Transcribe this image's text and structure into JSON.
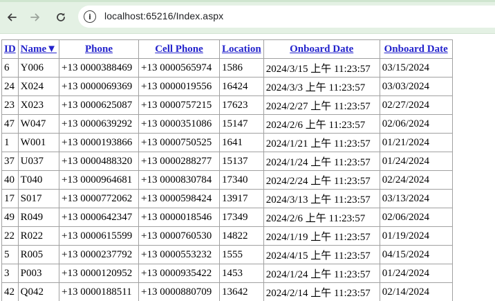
{
  "browser": {
    "url": "localhost:65216/Index.aspx",
    "site_info_glyph": "i",
    "icons": {
      "back": "arrow-left",
      "forward": "arrow-right",
      "reload": "reload"
    }
  },
  "table": {
    "headers": [
      "ID",
      "Name▼",
      "Phone",
      "Cell Phone",
      "Location",
      "Onboard Date",
      "Onboard Date"
    ],
    "rows": [
      [
        "6",
        "Y006",
        "+13 0000388469",
        "+13 0000565974",
        "1586",
        "2024/3/15 上午 11:23:57",
        "03/15/2024"
      ],
      [
        "24",
        "X024",
        "+13 0000069369",
        "+13 0000019556",
        "16424",
        "2024/3/3 上午 11:23:57",
        "03/03/2024"
      ],
      [
        "23",
        "X023",
        "+13 0000625087",
        "+13 0000757215",
        "17623",
        "2024/2/27 上午 11:23:57",
        "02/27/2024"
      ],
      [
        "47",
        "W047",
        "+13 0000639292",
        "+13 0000351086",
        "15147",
        "2024/2/6 上午 11:23:57",
        "02/06/2024"
      ],
      [
        "1",
        "W001",
        "+13 0000193866",
        "+13 0000750525",
        "1641",
        "2024/1/21 上午 11:23:57",
        "01/21/2024"
      ],
      [
        "37",
        "U037",
        "+13 0000488320",
        "+13 0000288277",
        "15137",
        "2024/1/24 上午 11:23:57",
        "01/24/2024"
      ],
      [
        "40",
        "T040",
        "+13 0000964681",
        "+13 0000830784",
        "17340",
        "2024/2/24 上午 11:23:57",
        "02/24/2024"
      ],
      [
        "17",
        "S017",
        "+13 0000772062",
        "+13 0000598424",
        "13917",
        "2024/3/13 上午 11:23:57",
        "03/13/2024"
      ],
      [
        "49",
        "R049",
        "+13 0000642347",
        "+13 0000018546",
        "17349",
        "2024/2/6 上午 11:23:57",
        "02/06/2024"
      ],
      [
        "22",
        "R022",
        "+13 0000615599",
        "+13 0000760530",
        "14822",
        "2024/1/19 上午 11:23:57",
        "01/19/2024"
      ],
      [
        "5",
        "R005",
        "+13 0000237792",
        "+13 0000553232",
        "1555",
        "2024/4/15 上午 11:23:57",
        "04/15/2024"
      ],
      [
        "3",
        "P003",
        "+13 0000120952",
        "+13 0000935422",
        "1453",
        "2024/1/24 上午 11:23:57",
        "01/24/2024"
      ],
      [
        "42",
        "Q042",
        "+13 0000188511",
        "+13 0000880709",
        "13642",
        "2024/2/14 上午 11:23:57",
        "02/14/2024"
      ]
    ]
  }
}
